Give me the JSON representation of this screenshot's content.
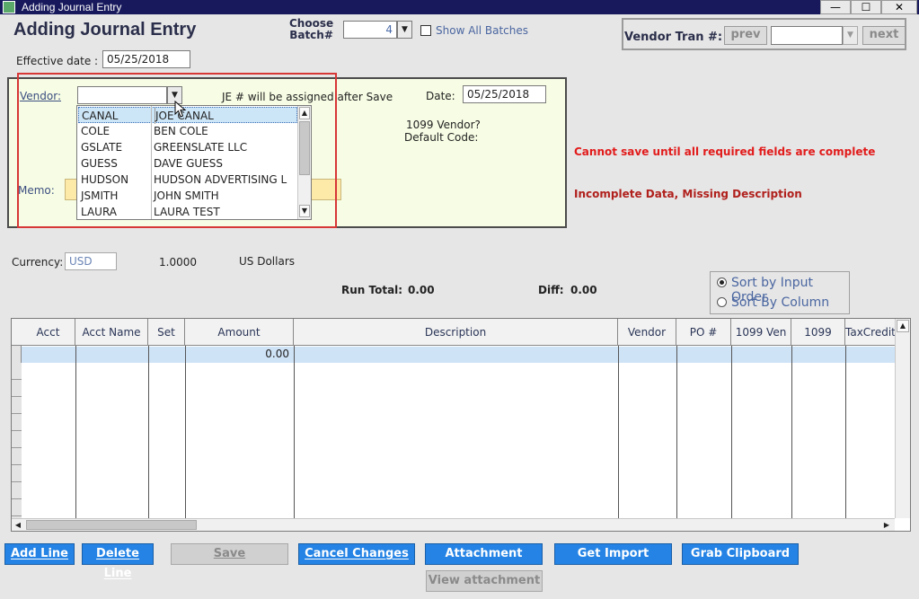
{
  "window": {
    "title": "Adding Journal Entry",
    "minimize": "—",
    "maximize": "☐",
    "close": "✕"
  },
  "header": {
    "heading": "Adding Journal Entry",
    "choose_batch_line1": "Choose",
    "choose_batch_line2": "Batch#",
    "batch_value": "4",
    "show_all_batches": "Show All Batches",
    "vendor_tran_label": "Vendor Tran #:",
    "prev": "prev",
    "next": "next"
  },
  "effective_date": {
    "label": "Effective date :",
    "value": "05/25/2018"
  },
  "entry": {
    "vendor_label": "Vendor:",
    "vendor_value": "",
    "je_note": "JE # will be assigned after Save",
    "date_label": "Date:",
    "date_value": "05/25/2018",
    "vendor_1099_label": "1099 Vendor?",
    "default_code_label": "Default Code:",
    "memo_label": "Memo:"
  },
  "vendor_dropdown": {
    "rows": [
      {
        "code": "CANAL",
        "name": "JOE CANAL",
        "selected": true
      },
      {
        "code": "COLE",
        "name": "BEN COLE"
      },
      {
        "code": "GSLATE",
        "name": "GREENSLATE LLC"
      },
      {
        "code": "GUESS",
        "name": "DAVE GUESS"
      },
      {
        "code": "HUDSON",
        "name": "HUDSON ADVERTISING L"
      },
      {
        "code": "JSMITH",
        "name": "JOHN SMITH"
      },
      {
        "code": "LAURA",
        "name": "LAURA TEST"
      }
    ]
  },
  "messages": {
    "error1": "Cannot save until all required fields are complete",
    "error2": "Incomplete Data, Missing Description"
  },
  "currency": {
    "label": "Currency:",
    "code": "USD",
    "rate": "1.0000",
    "name": "US Dollars"
  },
  "totals": {
    "run_total_label": "Run Total:",
    "run_total_value": "0.00",
    "diff_label": "Diff:",
    "diff_value": "0.00"
  },
  "sort": {
    "option1": "Sort by Input Order",
    "option2": "Sort By Column",
    "selected": "option1"
  },
  "grid": {
    "columns": [
      "Acct",
      "Acct Name",
      "Set",
      "Amount",
      "Description",
      "Vendor",
      "PO #",
      "1099 Ven",
      "1099",
      "TaxCredit"
    ],
    "first_row_amount": "0.00"
  },
  "buttons": {
    "add_line": "Add Line",
    "delete_line": "Delete Line",
    "save": "Save",
    "cancel_changes": "Cancel Changes",
    "attachment": "Attachment",
    "get_import": "Get Import",
    "grab_clipboard": "Grab Clipboard",
    "view_attachment": "View attachment"
  },
  "colors": {
    "title_bar": "#17195c",
    "button_blue": "#2483e4",
    "panel_bg": "#f7fde4",
    "error_red": "#e21b1b",
    "highlight": "#d73737"
  }
}
